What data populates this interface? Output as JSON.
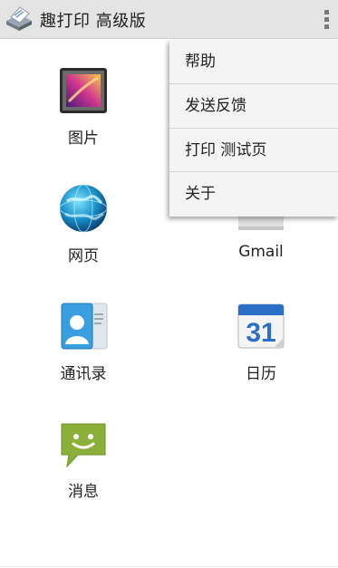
{
  "app_bar": {
    "title": "趣打印 高级版",
    "logo_icon": "printer-icon",
    "overflow_icon": "more-vertical-icon",
    "background": "#e4e4e4"
  },
  "grid": [
    {
      "label": "图片",
      "icon": "gallery-icon"
    },
    {
      "label": "",
      "icon": "hidden-under-menu"
    },
    {
      "label": "网页",
      "icon": "globe-icon"
    },
    {
      "label": "Gmail",
      "icon": "gmail-icon"
    },
    {
      "label": "通讯录",
      "icon": "contacts-icon"
    },
    {
      "label": "日历",
      "icon": "calendar-icon",
      "calendar_day": "31"
    },
    {
      "label": "消息",
      "icon": "messaging-icon"
    }
  ],
  "menu": {
    "items": [
      {
        "label": "帮助"
      },
      {
        "label": "发送反馈"
      },
      {
        "label": "打印 测试页"
      },
      {
        "label": "关于"
      }
    ]
  },
  "colors": {
    "menu_background": "#f4f4f4",
    "message_green": "#8bb03a",
    "calendar_blue": "#2b6fc6"
  }
}
